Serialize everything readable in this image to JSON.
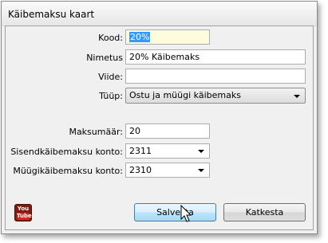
{
  "window": {
    "title": "Käibemaksu kaart"
  },
  "form": {
    "kood": {
      "label": "Kood:",
      "value": "20%"
    },
    "nimetus": {
      "label": "Nimetus",
      "value": "20% Käibemaks"
    },
    "viide": {
      "label": "Viide:",
      "value": ""
    },
    "tyyp": {
      "label": "Tüüp:",
      "value": "Ostu ja müügi käibemaks"
    },
    "maksumaar": {
      "label": "Maksumäär:",
      "value": "20"
    },
    "sisend_konto": {
      "label": "Sisendkäibemaksu konto:",
      "value": "2311"
    },
    "myygi_konto": {
      "label": "Müügikäibemaksu konto:",
      "value": "2310"
    }
  },
  "buttons": {
    "save": "Salvesta",
    "cancel": "Katkesta"
  },
  "youtube": {
    "you": "You",
    "tube": "Tube"
  },
  "colors": {
    "selection": "#3399ff",
    "focused_field_bg": "#fdfcdc",
    "button_hover": "#bee6fd"
  }
}
